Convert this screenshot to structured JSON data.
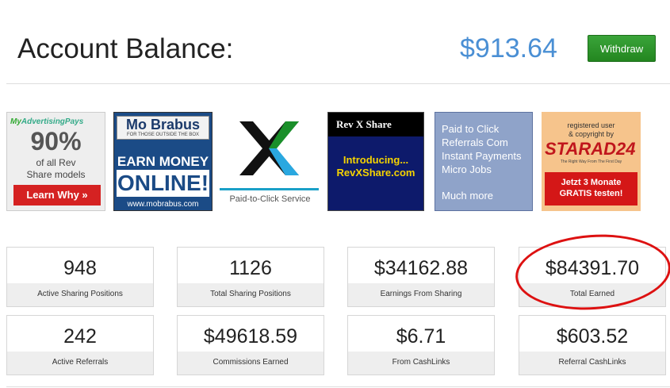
{
  "header": {
    "title": "Account Balance:",
    "balance": "$913.64",
    "withdraw_label": "Withdraw"
  },
  "ads": {
    "ad1": {
      "brand_a": "My",
      "brand_b": "AdvertisingPays",
      "big": "90%",
      "sub_1": "of all Rev",
      "sub_2": "Share models",
      "button": "Learn Why »"
    },
    "ad2": {
      "name": "Mo Brabus",
      "tagline": "FOR THOSE OUTSIDE THE BOX",
      "earn": "EARN MONEY",
      "online": "ONLINE!",
      "url": "www.mobrabus.com"
    },
    "ad3": {
      "caption": "Paid-to-Click Service"
    },
    "ad4": {
      "header": "Rev X Share",
      "line1": "Introducing...",
      "line2": "RevXShare.com"
    },
    "ad5": {
      "l1": "Paid to Click",
      "l2": "Referrals Com",
      "l3": "Instant Payments",
      "l4": "Micro Jobs",
      "l5": "Much more"
    },
    "ad6": {
      "reg_1": "registered user",
      "reg_2": "& copyright by",
      "logo": "STARAD24",
      "tagline": "The Right Way From The First Day",
      "promo_1": "Jetzt 3 Monate",
      "promo_2": "GRATIS testen!"
    }
  },
  "stats": [
    {
      "value": "948",
      "label": "Active Sharing Positions"
    },
    {
      "value": "1126",
      "label": "Total Sharing Positions"
    },
    {
      "value": "$34162.88",
      "label": "Earnings From Sharing"
    },
    {
      "value": "$84391.70",
      "label": "Total Earned"
    },
    {
      "value": "242",
      "label": "Active Referrals"
    },
    {
      "value": "$49618.59",
      "label": "Commissions Earned"
    },
    {
      "value": "$6.71",
      "label": "From CashLinks"
    },
    {
      "value": "$603.52",
      "label": "Referral CashLinks"
    }
  ],
  "colors": {
    "balance": "#4a8fd4",
    "withdraw": "#2d9a2a",
    "highlight_circle": "#dd1111"
  }
}
